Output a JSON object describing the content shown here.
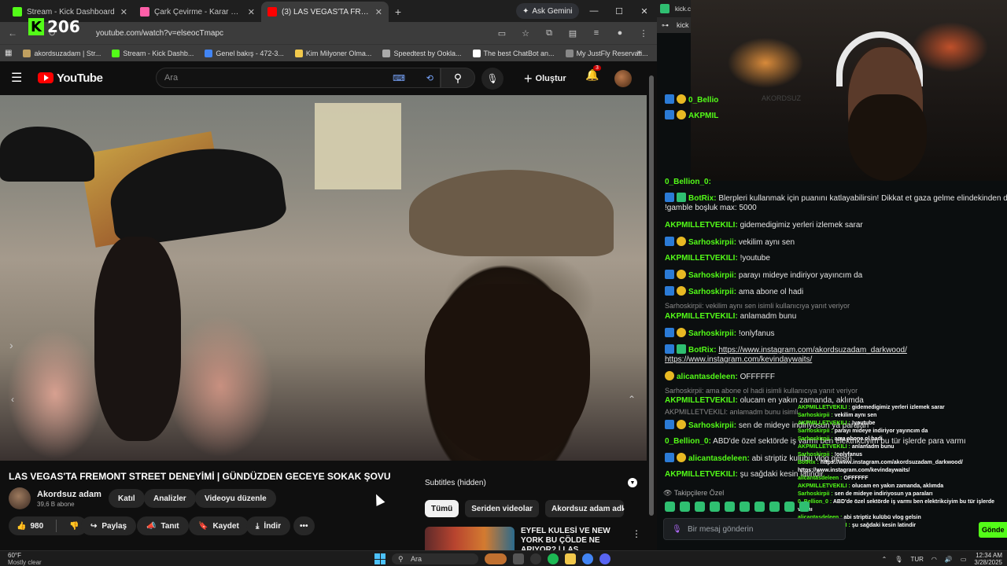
{
  "browser": {
    "tabs": [
      {
        "title": "Stream - Kick Dashboard",
        "color": "#53fc18"
      },
      {
        "title": "Çark Çevirme - Karar Çarkı",
        "color": "#ff5fa8"
      },
      {
        "title": "(3) LAS VEGAS'TA FREMONT ST...",
        "color": "#ff0000"
      }
    ],
    "ask_gemini": "Ask Gemini",
    "url": "youtube.com/watch?v=elseocTmapc",
    "kick_count": "206",
    "bookmarks": [
      {
        "label": "akordsuzadam | Str...",
        "color": "#c0a060"
      },
      {
        "label": "Stream - Kick Dashb...",
        "color": "#53fc18"
      },
      {
        "label": "Genel bakış - 472-3...",
        "color": "#4285f4"
      },
      {
        "label": "Kim Milyoner Olma...",
        "color": "#f2c94c"
      },
      {
        "label": "Speedtest by Ookla...",
        "color": "#aaaaaa"
      },
      {
        "label": "The best ChatBot an...",
        "color": "#ffffff"
      },
      {
        "label": "My JustFly Reservati...",
        "color": "#888888"
      }
    ]
  },
  "youtube": {
    "logo_text": "YouTube",
    "search_placeholder": "Ara",
    "create_label": "Oluştur",
    "notif_count": "3",
    "video_title": "LAS VEGAS'TA FREMONT STREET DENEYİMİ | GÜNDÜZDEN GECEYE SOKAK ŞOVU",
    "channel_name": "Akordsuz adam",
    "subs": "39,6 B abone",
    "buttons": {
      "join": "Katıl",
      "analytics": "Analizler",
      "edit": "Videoyu düzenle"
    },
    "likes": "980",
    "actions": {
      "share": "Paylaş",
      "promote": "Tanıt",
      "save": "Kaydet",
      "download": "İndir"
    },
    "subtitles": "Subtitles (hidden)",
    "chips": [
      "Tümü",
      "Seriden videolar",
      "Akordsuz adam adlı y"
    ],
    "rec_title": "EYFEL KULESİ VE NEW YORK BU ÇÖLDE NE ARIYOR? | LAS ..."
  },
  "chat": {
    "tab_title": "kick.co",
    "url": "kick",
    "messages": [
      {
        "user": "0_Bellio",
        "text": ""
      },
      {
        "user": "AKPMIL",
        "text": ""
      },
      {
        "user": "0_Bellion_0:",
        "text": ""
      },
      {
        "user": "BotRix:",
        "text": "Blerpleri kullanmak için puanını katlayabilirsin! Dikkat et gaza gelme elindekinden de olma."
      },
      {
        "user": "",
        "text": "!gamble boşluk max: 5000"
      },
      {
        "user": "AKPMILLETVEKILI:",
        "text": "gidemedigimiz yerleri izlemek sarar"
      },
      {
        "user": "Sarhoskirpii:",
        "text": "vekilim aynı sen"
      },
      {
        "user": "AKPMILLETVEKILI:",
        "text": "!youtube"
      },
      {
        "user": "Sarhoskirpii:",
        "text": "parayı mideye indiriyor yayıncım da"
      },
      {
        "user": "Sarhoskirpii:",
        "text": "ama abone ol hadi"
      },
      {
        "user": "",
        "text": "Sarhoskirpii: vekilim aynı sen isimli kullanıcıya yanıt veriyor"
      },
      {
        "user": "AKPMILLETVEKILI:",
        "text": "anlamadm bunu"
      },
      {
        "user": "Sarhoskirpii:",
        "text": "!onlyfanus"
      },
      {
        "user": "BotRix:",
        "text": "https://www.instagram.com/akordsuzadam_darkwood/"
      },
      {
        "user": "",
        "text": "https://www.instagram.com/kevindaywaits/"
      },
      {
        "user": "alicantasdeleen:",
        "text": "OFFFFFF"
      },
      {
        "user": "",
        "text": "Sarhoskirpii: ama abone ol hadi isimli kullanıcıya yanıt veriyor"
      },
      {
        "user": "AKPMILLETVEKILI:",
        "text": "olucam en yakın zamanda, aklımda"
      },
      {
        "user": "",
        "text": "AKPMILLETVEKILI: anlamadm bunu isimli"
      },
      {
        "user": "Sarhoskirpii:",
        "text": "sen de mideye indiriyosun ya paraları"
      },
      {
        "user": "0_Bellion_0:",
        "text": "ABD'de özel sektörde iş varmı ben elektrikciyim bu tür işlerde para varmı"
      },
      {
        "user": "alicantasdeleen:",
        "text": "abi striptiz kulübü vlog gelsin"
      },
      {
        "user": "AKPMILLETVEKILI:",
        "text": "şu sağdaki kesin latindir"
      }
    ],
    "mini": [
      {
        "user": "AKPMILLETVEKILI :",
        "text": "gidemedigimiz yerleri izlemek sarar"
      },
      {
        "user": "Sarhoskirpii :",
        "text": "vekilim aynı sen"
      },
      {
        "user": "AKPMILLETVEKILI :",
        "text": "!youtube"
      },
      {
        "user": "Sarhoskirpii :",
        "text": "parayı mideye indiriyor yayıncım da"
      },
      {
        "user": "Sarhoskirpii :",
        "text": "ama abone ol hadi"
      },
      {
        "user": "AKPMILLETVEKILI :",
        "text": "anlamadm bunu"
      },
      {
        "user": "Sarhoskirpii :",
        "text": "!onlyfanus"
      },
      {
        "user": "BotRix :",
        "text": "https://www.instagram.com/akordsuzadam_darkwood/"
      },
      {
        "user": "",
        "text": "https://www.instagram.com/kevindaywaits/"
      },
      {
        "user": "alicantasdeleen :",
        "text": "OFFFFFF"
      },
      {
        "user": "AKPMILLETVEKILI :",
        "text": "olucam en yakın zamanda, aklımda"
      },
      {
        "user": "Sarhoskirpii :",
        "text": "sen de mideye indiriyosun ya paraları"
      },
      {
        "user": "0_Bellion_0 :",
        "text": "ABD'de özel sektörde iş varmı ben elektrikciyim bu tür işlerde para"
      },
      {
        "user": "",
        "text": "varmı"
      },
      {
        "user": "alicantasdeleen :",
        "text": "abi striptiz kulübü vlog gelsin"
      },
      {
        "user": "AKPMILLETVEKILI :",
        "text": "şu sağdaki kesin latindir"
      }
    ],
    "takip_label": "Takipçilere Özel",
    "input_placeholder": "Bir mesaj gönderin",
    "send_label": "Gönde",
    "webcam_sign": "AKORDSUZ"
  },
  "taskbar": {
    "temp": "60°F",
    "weather": "Mostly clear",
    "search": "Ara",
    "lang": "TUR",
    "time": "12:34 AM",
    "date": "3/28/2025"
  }
}
